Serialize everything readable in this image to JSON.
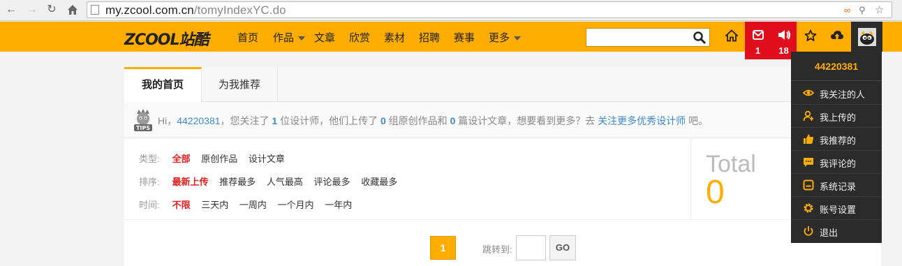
{
  "browser": {
    "url_host": "my.zcool.com.cn",
    "url_path": "/tomyIndexYC.do"
  },
  "topnav": {
    "logo": "ZCOOL站酷",
    "menu": [
      {
        "label": "首页",
        "dropdown": false
      },
      {
        "label": "作品",
        "dropdown": true
      },
      {
        "label": "文章",
        "dropdown": false
      },
      {
        "label": "欣赏",
        "dropdown": false
      },
      {
        "label": "素材",
        "dropdown": false
      },
      {
        "label": "招聘",
        "dropdown": false
      },
      {
        "label": "赛事",
        "dropdown": false
      },
      {
        "label": "更多",
        "dropdown": true
      }
    ],
    "search_value": "",
    "mail_count": "1",
    "notice_count": "18",
    "accent": "#ffad00",
    "alert_color": "#e00e1c"
  },
  "tabs": [
    {
      "label": "我的首页",
      "active": true
    },
    {
      "label": "为我推荐",
      "active": false
    }
  ],
  "tips": {
    "greeting": "Hi，",
    "user": "44220381",
    "t1": "，您关注了 ",
    "followed": "1",
    "t2": " 位设计师，他们上传了 ",
    "works": "0",
    "t3": " 组原创作品和 ",
    "articles": "0",
    "t4": " 篇设计文章，想要看到更多？去 ",
    "link": "关注更多优秀设计师",
    "t5": " 吧。"
  },
  "filters": {
    "type": {
      "label": "类型:",
      "options": [
        "全部",
        "原创作品",
        "设计文章"
      ],
      "active": 0
    },
    "sort": {
      "label": "排序:",
      "options": [
        "最新上传",
        "推荐最多",
        "人气最高",
        "评论最多",
        "收藏最多"
      ],
      "active": 0
    },
    "time": {
      "label": "时间:",
      "options": [
        "不限",
        "三天内",
        "一周内",
        "一个月内",
        "一年内"
      ],
      "active": 0
    }
  },
  "total": {
    "label": "Total",
    "value": "0"
  },
  "pager": {
    "current": "1",
    "jump_label": "跳转到:",
    "go": "GO"
  },
  "dropdown": {
    "user": "44220381",
    "items": [
      {
        "label": "我关注的人",
        "icon": "eye-icon"
      },
      {
        "label": "我上传的",
        "icon": "upload-user-icon"
      },
      {
        "label": "我推荐的",
        "icon": "thumbs-up-icon"
      },
      {
        "label": "我评论的",
        "icon": "comment-icon"
      },
      {
        "label": "系统记录",
        "icon": "system-record-icon"
      },
      {
        "label": "账号设置",
        "icon": "gear-icon"
      },
      {
        "label": "退出",
        "icon": "power-icon"
      }
    ]
  }
}
